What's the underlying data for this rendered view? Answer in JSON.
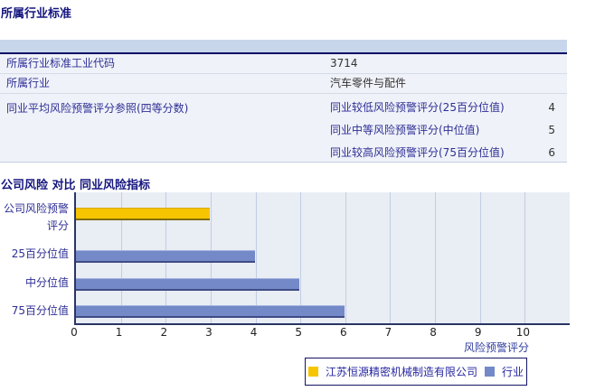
{
  "colors": {
    "title_navy": "#15157F",
    "label_navy": "#2E2E96",
    "value_dark": "#333333",
    "table_header_bg": "#C8D6EC",
    "table_header_border": "#050A66",
    "row_bg": "#EFF2F8",
    "plot_bg": "#E9EDF4",
    "gridline": "#C3CEE3",
    "axis": "#2A3564",
    "company_bar": "#F6C500",
    "industry_bar": "#7389C8"
  },
  "section_industry": {
    "title": "所属行业标准",
    "rows": [
      {
        "label": "所属行业标准工业代码",
        "value": "3714"
      },
      {
        "label": "所属行业",
        "value": "汽车零件与配件"
      },
      {
        "label": "同业平均风险预警评分参照(四等分数)"
      }
    ],
    "subrows": [
      {
        "label": "同业较低风险预警评分(25百分位值)",
        "value": "4"
      },
      {
        "label": "同业中等风险预警评分(中位值)",
        "value": "5"
      },
      {
        "label": "同业较高风险预警评分(75百分位值)",
        "value": "6"
      }
    ]
  },
  "section_chart": {
    "title": "公司风险 对比 同业风险指标"
  },
  "chart_data": {
    "type": "bar",
    "orientation": "horizontal",
    "title": "公司风险 对比 同业风险指标",
    "categories": [
      "公司风险预警评分",
      "25百分位值",
      "中分位值",
      "75百分位值"
    ],
    "category_label_lines": [
      [
        "公司风险预警",
        "评分"
      ],
      [
        "25百分位值"
      ],
      [
        "中分位值"
      ],
      [
        "75百分位值"
      ]
    ],
    "values": [
      3,
      4,
      5,
      6
    ],
    "series": [
      {
        "name": "江苏恒源精密机械制造有限公司",
        "color": "#F6C500",
        "values": [
          3,
          null,
          null,
          null
        ]
      },
      {
        "name": "行业",
        "color": "#7389C8",
        "values": [
          null,
          4,
          5,
          6
        ]
      }
    ],
    "xlabel": "风险预警评分",
    "xticks": [
      0,
      1,
      2,
      3,
      4,
      5,
      6,
      7,
      8,
      9,
      10
    ],
    "xlim": [
      0,
      11
    ],
    "grid": true,
    "legend_position": "bottom"
  }
}
